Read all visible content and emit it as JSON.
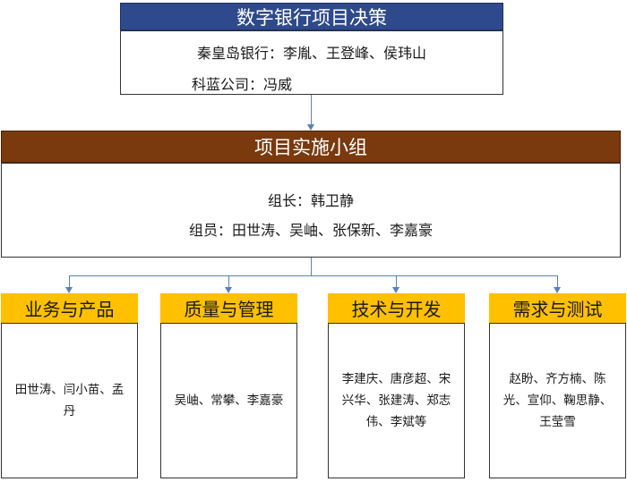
{
  "decision": {
    "title": "数字银行项目决策",
    "lines": [
      "秦皇岛银行：李胤、王登峰、侯玮山",
      "科蓝公司：冯威"
    ]
  },
  "group": {
    "title": "项目实施小组",
    "lines": [
      "组长：韩卫静",
      "组员：田世涛、吴岫、张保新、李嘉豪"
    ]
  },
  "divisions": [
    {
      "title": "业务与产品",
      "members": "田世涛、闫小苗、孟丹"
    },
    {
      "title": "质量与管理",
      "members": "吴岫、常攀、李嘉豪"
    },
    {
      "title": "技术与开发",
      "members": "李建庆、唐彦超、宋兴华、张建涛、郑志伟、李斌等"
    },
    {
      "title": "需求与测试",
      "members": "赵盼、齐方楠、陈光、宣仰、鞠思静、王莹雪"
    }
  ],
  "colors": {
    "decision_header": "#2e4a8c",
    "group_header": "#7a3a0e",
    "division_header": "#ffc000",
    "connector": "#5a82b0"
  }
}
